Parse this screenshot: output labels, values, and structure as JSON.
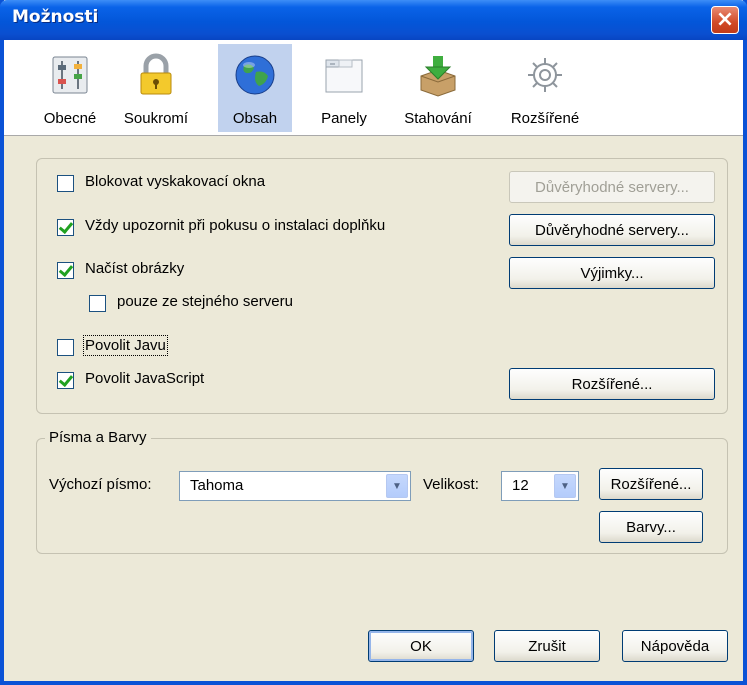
{
  "window": {
    "title": "Možnosti",
    "close": "×"
  },
  "toolbar": {
    "items": [
      {
        "label": "Obecné",
        "icon": "general-settings-icon"
      },
      {
        "label": "Soukromí",
        "icon": "padlock-icon"
      },
      {
        "label": "Obsah",
        "icon": "globe-icon",
        "selected": true
      },
      {
        "label": "Panely",
        "icon": "tabs-window-icon"
      },
      {
        "label": "Stahování",
        "icon": "download-box-icon"
      },
      {
        "label": "Rozšířené",
        "icon": "gear-icon"
      }
    ]
  },
  "content": {
    "block_popups": {
      "label": "Blokovat vyskakovací okna",
      "checked": false
    },
    "warn_addons": {
      "label": "Vždy upozornit při pokusu o instalaci doplňku",
      "checked": true
    },
    "load_images": {
      "label": "Načíst obrázky",
      "checked": true
    },
    "same_server": {
      "label": "pouze ze stejného serveru",
      "checked": false
    },
    "enable_java": {
      "label": "Povolit Javu",
      "checked": false
    },
    "enable_js": {
      "label": "Povolit JavaScript",
      "checked": true
    },
    "trusted_servers_disabled": "Důvěryhodné servery...",
    "trusted_servers": "Důvěryhodné servery...",
    "exceptions": "Výjimky...",
    "advanced": "Rozšířené..."
  },
  "fonts": {
    "legend": "Písma a Barvy",
    "default_font_label": "Výchozí písmo:",
    "default_font_value": "Tahoma",
    "size_label": "Velikost:",
    "size_value": "12",
    "advanced": "Rozšířené...",
    "colors": "Barvy..."
  },
  "footer": {
    "ok": "OK",
    "cancel": "Zrušit",
    "help": "Nápověda"
  },
  "colors": {
    "selected_tab": "#c1d2ee",
    "titlebar": "#0356d9",
    "dialog_bg": "#ece9d8"
  }
}
